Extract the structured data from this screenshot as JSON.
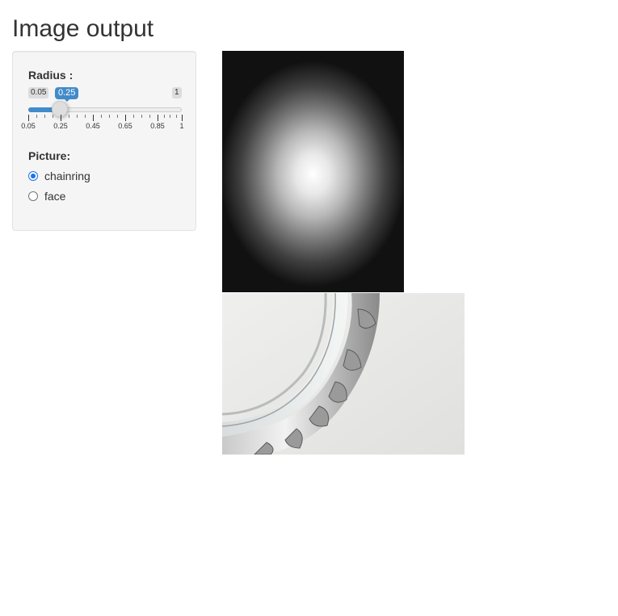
{
  "page": {
    "title": "Image output"
  },
  "slider": {
    "label": "Radius :",
    "min_label": "0.05",
    "max_label": "1",
    "value_label": "0.25",
    "min": 0.05,
    "max": 1,
    "value": 0.25,
    "ticks": [
      "0.05",
      "0.25",
      "0.45",
      "0.65",
      "0.85",
      "1"
    ],
    "accent": "#428bca"
  },
  "picture": {
    "label": "Picture:",
    "options": [
      {
        "label": "chainring",
        "selected": true
      },
      {
        "label": "face",
        "selected": false
      }
    ]
  },
  "images": {
    "top": "radial gradient blob (white center fading to black)",
    "bottom": "chainring photo"
  }
}
